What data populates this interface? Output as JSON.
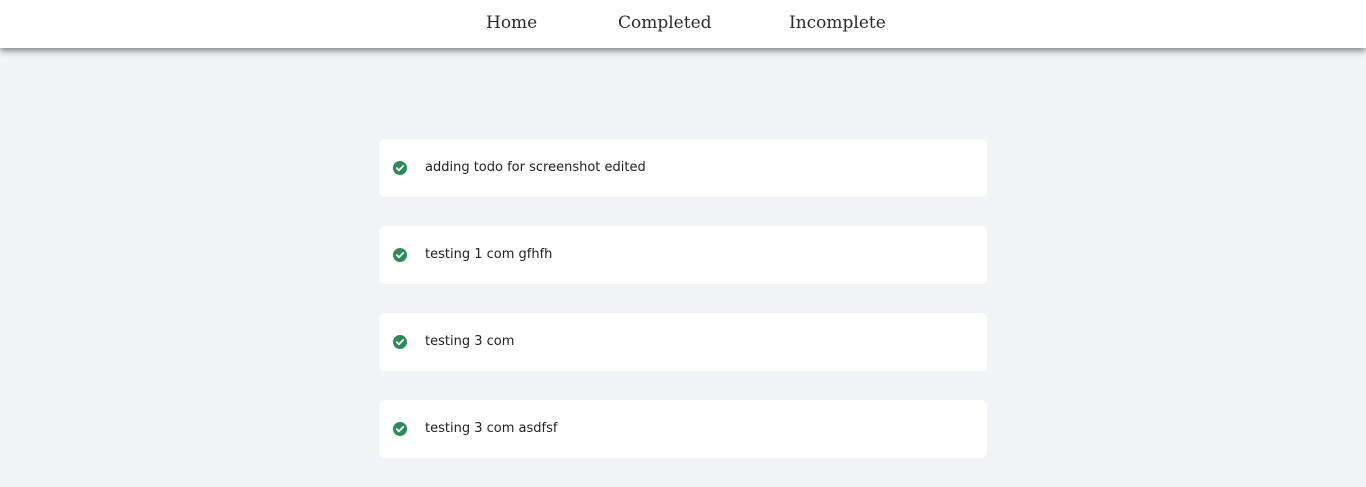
{
  "nav": {
    "links": [
      {
        "label": "Home"
      },
      {
        "label": "Completed"
      },
      {
        "label": "Incomplete"
      }
    ]
  },
  "todos": [
    {
      "text": "adding todo for screenshot edited",
      "status": "completed",
      "icon": "check-circle-icon"
    },
    {
      "text": "testing 1 com gfhfh",
      "status": "completed",
      "icon": "check-circle-icon"
    },
    {
      "text": "testing 3 com",
      "status": "completed",
      "icon": "check-circle-icon"
    },
    {
      "text": "testing 3 com asdfsf",
      "status": "completed",
      "icon": "check-circle-icon"
    }
  ],
  "colors": {
    "background": "#f2f3f6",
    "card": "#ffffff",
    "check": "#2e8b57",
    "nav_text": "#2b2b2b"
  }
}
